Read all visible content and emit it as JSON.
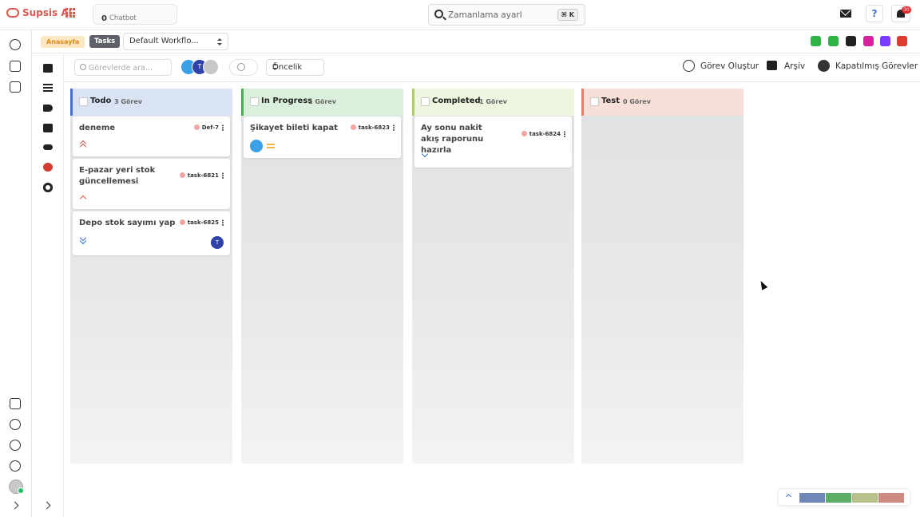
{
  "app": {
    "name": "Supsis Ai"
  },
  "chatbot": {
    "count": "0",
    "label": "Chatbot"
  },
  "search": {
    "placeholder": "Zamanlama ayarl",
    "shortcut": "⌘ K"
  },
  "notifications": {
    "badge": "30",
    "help": "?"
  },
  "breadcrumb": {
    "home": "Anasayfa",
    "current": "Tasks",
    "workflow": "Default Workflo..."
  },
  "channels": [
    {
      "name": "robot-icon",
      "color": "#2fb344"
    },
    {
      "name": "list-icon",
      "color": "#2fb344"
    },
    {
      "name": "wifi-icon",
      "color": "#222222"
    },
    {
      "name": "instagram-icon",
      "color": "#d6249f"
    },
    {
      "name": "messenger-icon",
      "color": "#7a3cff"
    },
    {
      "name": "web-icon",
      "color": "#e03b2f"
    }
  ],
  "toolbar": {
    "search_placeholder": "Görevlerde ara...",
    "priority": "Öncelik",
    "create_task": "Görev Oluştur",
    "archive": "Arşiv",
    "closed_tasks": "Kapatılmış Görevler",
    "avatar_letters": [
      "",
      "T",
      ""
    ]
  },
  "columns": [
    {
      "name": "Todo",
      "count": "3 Görev",
      "color": "#d9e3f3",
      "accent": "#4a6fd4",
      "cards": [
        {
          "title": "deneme",
          "id": "Def-7",
          "priority": "highest",
          "assignee": ""
        },
        {
          "title": "E-pazar yeri stok güncellemesi",
          "id": "task-6821",
          "priority": "high",
          "assignee": ""
        },
        {
          "title": "Depo stok sayımı yap",
          "id": "task-6825",
          "priority": "lowest",
          "assignee": "T"
        }
      ]
    },
    {
      "name": "In Progress",
      "count": "1 Görev",
      "color": "#dbf0dc",
      "accent": "#46b04a",
      "cards": [
        {
          "title": "Şikayet bileti kapat",
          "id": "task-6823",
          "priority": "medium",
          "assignee": ""
        }
      ]
    },
    {
      "name": "Completed",
      "count": "1 Görev",
      "color": "#eef6e0",
      "accent": "#a9cf6a",
      "cards": [
        {
          "title": "Ay sonu nakit akış raporunu hazırla",
          "id": "task-6824",
          "priority": "low",
          "assignee": ""
        }
      ]
    },
    {
      "name": "Test",
      "count": "0 Görev",
      "color": "#f8e0d9",
      "accent": "#e2826c",
      "cards": []
    }
  ],
  "colors": {
    "high": "#e0574f",
    "low": "#3a6fd8",
    "medium": "#f2b542",
    "avatar_blue": "#3ba0e6",
    "avatar_navy": "#2f43a8"
  },
  "bottom_widget": {
    "segments": [
      "#6f86b8",
      "#5eae6a",
      "#b6c08b",
      "#cf8a80"
    ]
  }
}
